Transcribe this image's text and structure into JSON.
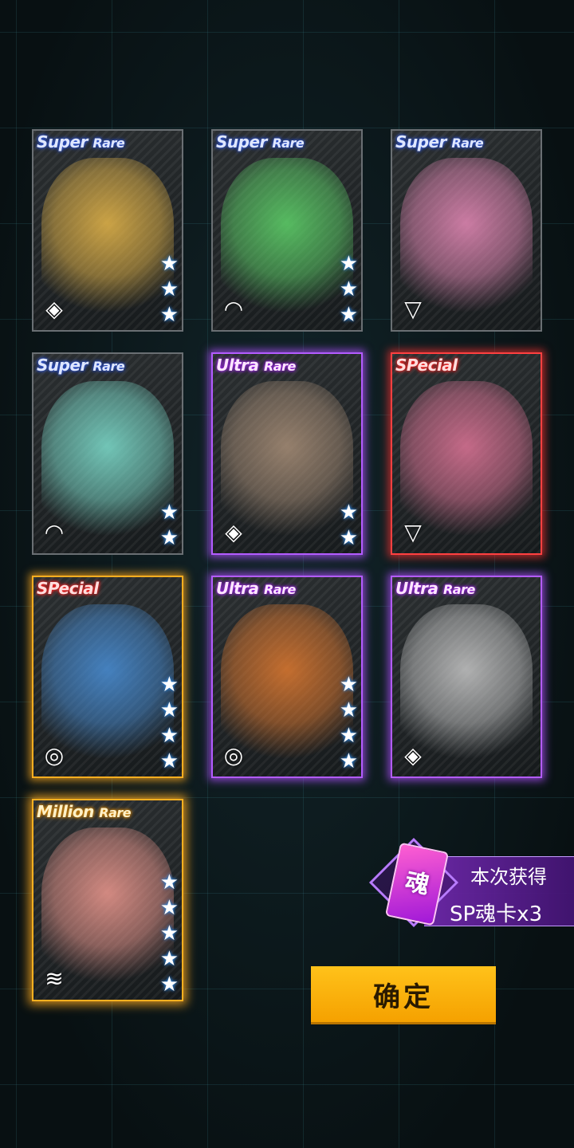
{
  "cards": [
    {
      "rarity": "Super",
      "rarity2": "Rare",
      "tier": "sr",
      "stars": 3,
      "type": "diamond-icon",
      "art": "#e8b84a"
    },
    {
      "rarity": "Super",
      "rarity2": "Rare",
      "tier": "sr",
      "stars": 3,
      "type": "wifi-icon",
      "art": "#5fd46a"
    },
    {
      "rarity": "Super",
      "rarity2": "Rare",
      "tier": "sr",
      "stars": 0,
      "type": "triangle-icon",
      "art": "#e88ab8"
    },
    {
      "rarity": "Super",
      "rarity2": "Rare",
      "tier": "sr",
      "stars": 2,
      "type": "wifi-icon",
      "art": "#7fe0cf"
    },
    {
      "rarity": "Ultra",
      "rarity2": "Rare",
      "tier": "ur",
      "stars": 2,
      "type": "diamond-icon",
      "art": "#a98f78"
    },
    {
      "rarity": "SPecial",
      "rarity2": "",
      "tier": "sp",
      "stars": 0,
      "type": "triangle-icon",
      "art": "#e07598"
    },
    {
      "rarity": "SPecial",
      "rarity2": "",
      "tier": "spo",
      "stars": 4,
      "type": "drop-icon",
      "art": "#4a90d8"
    },
    {
      "rarity": "Ultra",
      "rarity2": "Rare",
      "tier": "ur",
      "stars": 4,
      "type": "drop-icon",
      "art": "#e07a30"
    },
    {
      "rarity": "Ultra",
      "rarity2": "Rare",
      "tier": "ur",
      "stars": 0,
      "type": "diamond-icon",
      "art": "#c8c8c8"
    },
    {
      "rarity": "Million",
      "rarity2": "Rare",
      "tier": "mr",
      "stars": 5,
      "type": "tower-icon",
      "art": "#f09a90"
    }
  ],
  "badge": {
    "icon_text": "魂",
    "line1": "本次获得",
    "line2": "SP魂卡x3"
  },
  "confirm_label": "确定"
}
